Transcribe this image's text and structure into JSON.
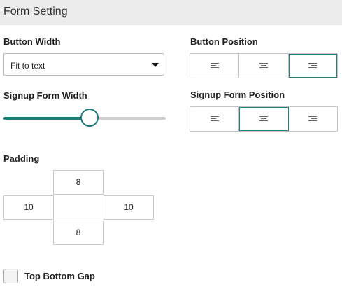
{
  "header": {
    "title": "Form Setting"
  },
  "button_width": {
    "label": "Button Width",
    "selected": "Fit to text"
  },
  "button_position": {
    "label": "Button Position",
    "options": [
      "align-left",
      "align-center",
      "align-right"
    ],
    "selected": "align-right"
  },
  "signup_form_width": {
    "label": "Signup Form Width",
    "value_fraction": 0.53
  },
  "signup_form_position": {
    "label": "Signup Form Position",
    "options": [
      "align-left",
      "align-center",
      "align-right"
    ],
    "selected": "align-center"
  },
  "padding": {
    "label": "Padding",
    "top": "8",
    "left": "10",
    "right": "10",
    "bottom": "8"
  },
  "top_bottom_gap": {
    "label": "Top Bottom Gap",
    "checked": false
  },
  "colors": {
    "accent": "#1f7a7a",
    "track": "#cfcfcf",
    "header_bg": "#ececec"
  }
}
